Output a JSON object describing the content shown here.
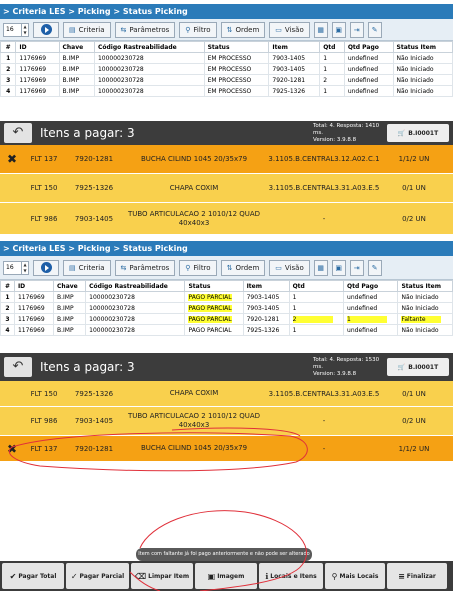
{
  "p1": {
    "breadcrumb": "> Criteria LES > Picking > Status Picking",
    "page": "16",
    "buttons": {
      "criteria": "Criteria",
      "parametros": "Parâmetros",
      "filtro": "Filtro",
      "ordem": "Ordem",
      "visao": "Visão"
    },
    "columns": [
      "#",
      "ID",
      "Chave",
      "Código Rastreabilidade",
      "Status",
      "Item",
      "Qtd",
      "Qtd Pago",
      "Status Item"
    ],
    "rows": [
      [
        "1",
        "1176969",
        "B.IMP",
        "100000230728",
        "EM PROCESSO",
        "7903-1405",
        "1",
        "undefined",
        "Não Iniciado"
      ],
      [
        "2",
        "1176969",
        "B.IMP",
        "100000230728",
        "EM PROCESSO",
        "7903-1405",
        "1",
        "undefined",
        "Não Iniciado"
      ],
      [
        "3",
        "1176969",
        "B.IMP",
        "100000230728",
        "EM PROCESSO",
        "7920-1281",
        "2",
        "undefined",
        "Não Iniciado"
      ],
      [
        "4",
        "1176969",
        "B.IMP",
        "100000230728",
        "EM PROCESSO",
        "7925-1326",
        "1",
        "undefined",
        "Não Iniciado"
      ]
    ]
  },
  "m1": {
    "title": "Itens a pagar: 3",
    "info1": "Total: 4. Resposta: 1410 ms.",
    "info2": "Version: 3.9.8.8",
    "cart": "B.I0001T",
    "items": [
      {
        "mark": "✖",
        "loc": "FLT 137",
        "code": "7920-1281",
        "desc": "BUCHA CILIND 1045 20/35x79",
        "addr": "3.1105.B.CENTRAL3.12.A02.C.1",
        "qty": "1/1/2 UN",
        "color": "orange"
      },
      {
        "loc": "FLT 150",
        "code": "7925-1326",
        "desc": "CHAPA COXIM",
        "addr": "3.1105.B.CENTRAL3.31.A03.E.5",
        "qty": "0/1 UN",
        "color": "yellow"
      },
      {
        "loc": "FLT 986",
        "code": "7903-1405",
        "desc": "TUBO ARTICULACAO 2 1010/12 QUAD 40x40x3",
        "addr": "-",
        "qty": "0/2 UN",
        "color": "yellow"
      }
    ]
  },
  "p2": {
    "breadcrumb": "> Criteria LES > Picking > Status Picking",
    "page": "16",
    "buttons": {
      "criteria": "Criteria",
      "parametros": "Parâmetros",
      "filtro": "Filtro",
      "ordem": "Ordem",
      "visao": "Visão"
    },
    "columns": [
      "#",
      "ID",
      "Chave",
      "Código Rastreabilidade",
      "Status",
      "Item",
      "Qtd",
      "Qtd Pago",
      "Status Item"
    ],
    "rows": [
      [
        "1",
        "1176969",
        "B.IMP",
        "100000230728",
        "PAGO PARCIAL",
        "7903-1405",
        "1",
        "undefined",
        "Não Iniciado"
      ],
      [
        "2",
        "1176969",
        "B.IMP",
        "100000230728",
        "PAGO PARCIAL",
        "7903-1405",
        "1",
        "undefined",
        "Não Iniciado"
      ],
      [
        "3",
        "1176969",
        "B.IMP",
        "100000230728",
        "PAGO PARCIAL",
        "7920-1281",
        "2",
        "1",
        "Faltante"
      ],
      [
        "4",
        "1176969",
        "B.IMP",
        "100000230728",
        "PAGO PARCIAL",
        "7925-1326",
        "1",
        "undefined",
        "Não Iniciado"
      ]
    ]
  },
  "m2": {
    "title": "Itens a pagar: 3",
    "info1": "Total: 4. Resposta: 1530 ms.",
    "info2": "Version: 3.9.8.8",
    "cart": "B.I0001T",
    "items": [
      {
        "loc": "FLT 150",
        "code": "7925-1326",
        "desc": "CHAPA COXIM",
        "addr": "3.1105.B.CENTRAL3.31.A03.E.5",
        "qty": "0/1 UN",
        "color": "yellow"
      },
      {
        "loc": "FLT 986",
        "code": "7903-1405",
        "desc": "TUBO ARTICULACAO 2 1010/12 QUAD 40x40x3",
        "addr": "-",
        "qty": "0/2 UN",
        "color": "yellow"
      },
      {
        "mark": "✖",
        "loc": "FLT 137",
        "code": "7920-1281",
        "desc": "BUCHA CILIND 1045 20/35x79",
        "addr": "-",
        "qty": "1/1/2 UN",
        "color": "orange"
      }
    ],
    "toast": "Item com faltante já foi pago anteriormente e não pode ser alterado",
    "actions": [
      "Pagar Total",
      "Pagar Parcial",
      "Limpar Item",
      "Imagem",
      "Locais e Itens",
      "Mais Locais",
      "Finalizar"
    ]
  },
  "colors": {
    "yellow": "#f9d04d",
    "orange": "#f5a114",
    "blue": "#2b7bb9",
    "dark": "#3c3c3c",
    "highlight": "#ffff33",
    "annotation": "#e0303a"
  }
}
